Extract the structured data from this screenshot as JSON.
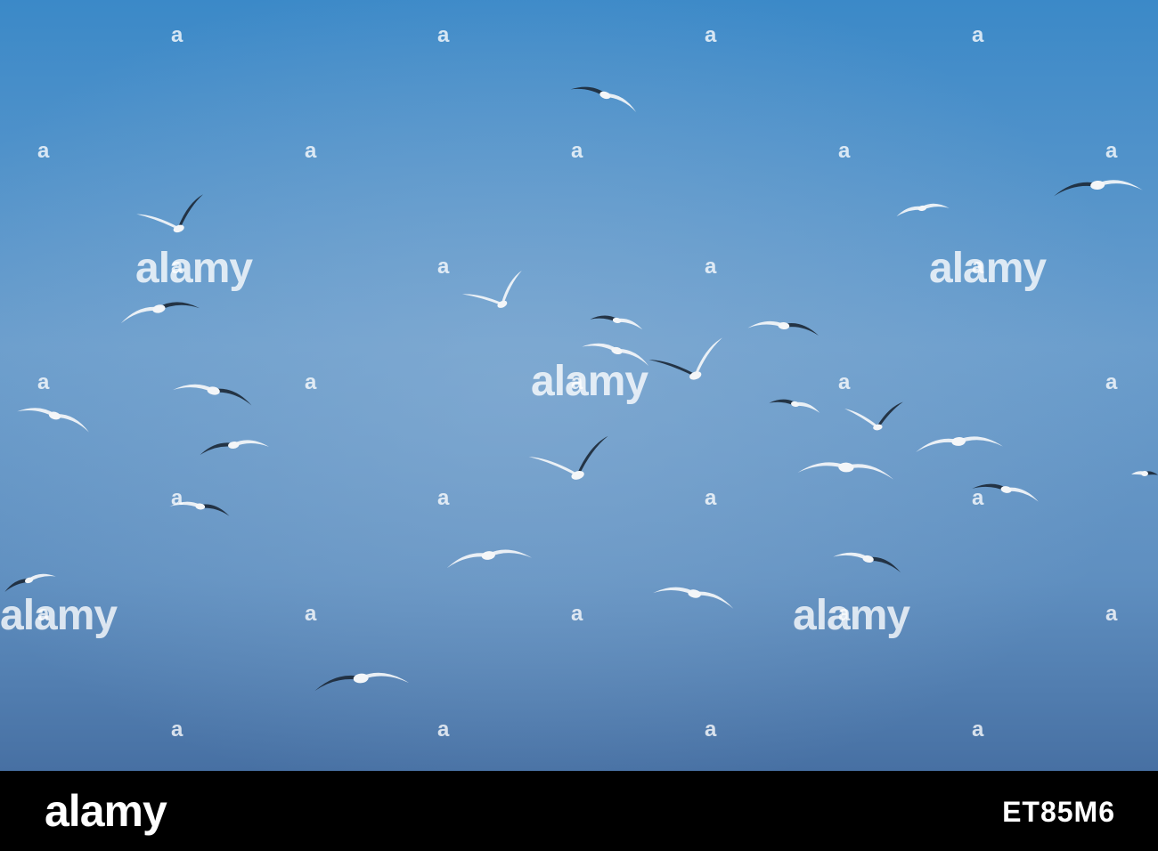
{
  "image": {
    "description_colors": {
      "sky_top": "#3d8ac7",
      "sky_mid": "#6fa0cc",
      "sky_bottom": "#4a78a8",
      "bird": "#f4f6f8",
      "bird_dark": "#1d2a3a",
      "footer_bg": "#000000"
    },
    "watermarks": {
      "logo_text": "alamy",
      "mark_text": "a"
    }
  },
  "footer": {
    "logo": "alamy",
    "image_id": "ET85M6"
  }
}
